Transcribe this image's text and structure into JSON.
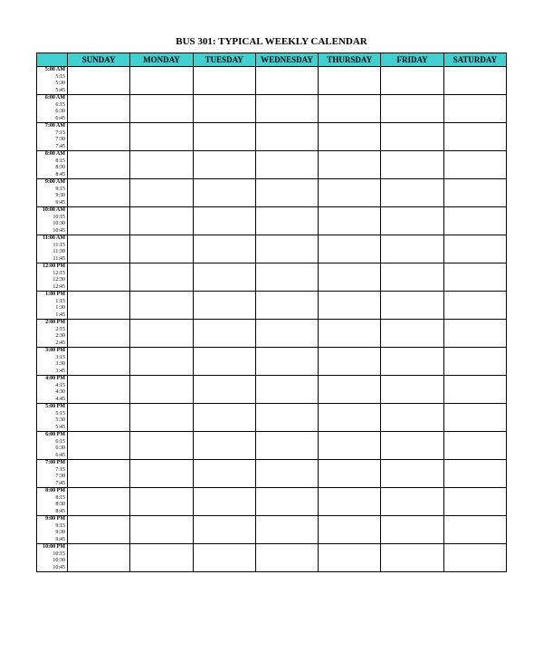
{
  "title": "BUS 301: TYPICAL WEEKLY CALENDAR",
  "days": [
    "SUNDAY",
    "MONDAY",
    "TUESDAY",
    "WEDNESDAY",
    "THURSDAY",
    "FRIDAY",
    "SATURDAY"
  ],
  "hours": [
    {
      "label": "5:00 AM",
      "sub": [
        "5:15",
        "5:30",
        "5:45"
      ]
    },
    {
      "label": "6:00 AM",
      "sub": [
        "6:15",
        "6:30",
        "6:45"
      ]
    },
    {
      "label": "7:00 AM",
      "sub": [
        "7:15",
        "7:30",
        "7:45"
      ]
    },
    {
      "label": "8:00 AM",
      "sub": [
        "8:15",
        "8:30",
        "8:45"
      ]
    },
    {
      "label": "9:00 AM",
      "sub": [
        "9:15",
        "9:30",
        "9:45"
      ]
    },
    {
      "label": "10:00 AM",
      "sub": [
        "10:15",
        "10:30",
        "10:45"
      ]
    },
    {
      "label": "11:00 AM",
      "sub": [
        "11:15",
        "11:30",
        "11:45"
      ]
    },
    {
      "label": "12:00 PM",
      "sub": [
        "12:15",
        "12:30",
        "12:45"
      ]
    },
    {
      "label": "1:00 PM",
      "sub": [
        "1:15",
        "1:30",
        "1:45"
      ]
    },
    {
      "label": "2:00 PM",
      "sub": [
        "2:15",
        "2:30",
        "2:45"
      ]
    },
    {
      "label": "3:00 PM",
      "sub": [
        "3:15",
        "3:30",
        "3:45"
      ]
    },
    {
      "label": "4:00 PM",
      "sub": [
        "4:15",
        "4:30",
        "4:45"
      ]
    },
    {
      "label": "5:00 PM",
      "sub": [
        "5:15",
        "5:30",
        "5:45"
      ]
    },
    {
      "label": "6:00 PM",
      "sub": [
        "6:15",
        "6:30",
        "6:45"
      ]
    },
    {
      "label": "7:00 PM",
      "sub": [
        "7:15",
        "7:30",
        "7:45"
      ]
    },
    {
      "label": "8:00 PM",
      "sub": [
        "8:15",
        "8:30",
        "8:45"
      ]
    },
    {
      "label": "9:00 PM",
      "sub": [
        "9:15",
        "9:30",
        "9:45"
      ]
    },
    {
      "label": "10:00 PM",
      "sub": [
        "10:15",
        "10:30",
        "10:45"
      ]
    }
  ],
  "colors": {
    "header_bg": "#40D0D0"
  }
}
